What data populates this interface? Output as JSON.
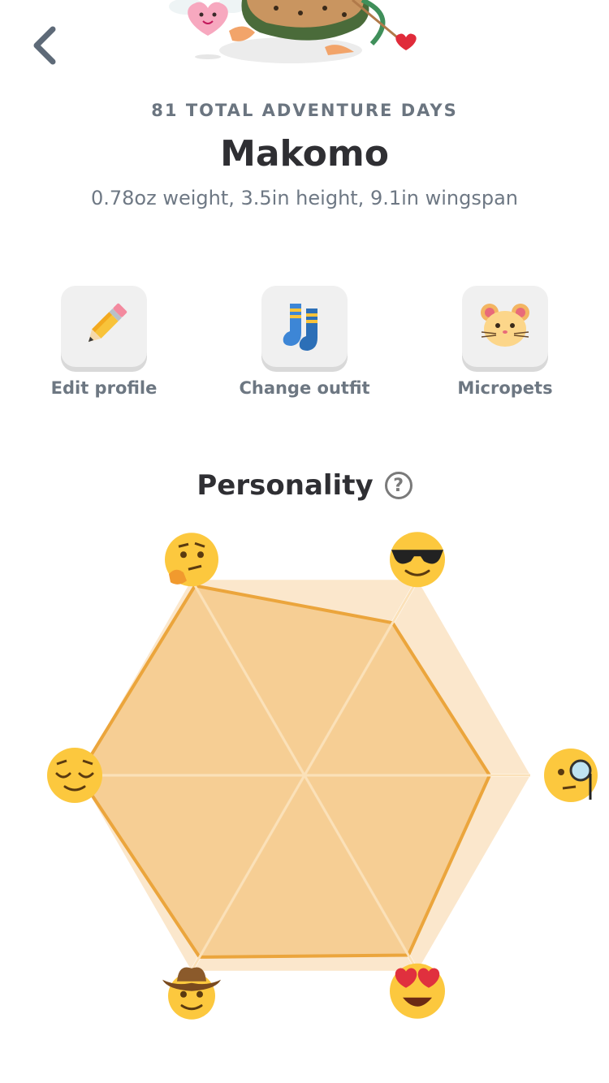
{
  "header": {
    "adventure_days": "81 TOTAL ADVENTURE DAYS",
    "name": "Makomo",
    "stats": "0.78oz weight, 3.5in height, 9.1in wingspan"
  },
  "actions": [
    {
      "label": "Edit profile",
      "icon": "pencil-icon"
    },
    {
      "label": "Change outfit",
      "icon": "socks-icon"
    },
    {
      "label": "Micropets",
      "icon": "hamster-icon"
    }
  ],
  "personality": {
    "title": "Personality",
    "help_glyph": "?",
    "traits": [
      {
        "icon": "thinking-face-icon",
        "value": 0.97
      },
      {
        "icon": "sunglasses-face-icon",
        "value": 0.78
      },
      {
        "icon": "monocle-face-icon",
        "value": 0.82
      },
      {
        "icon": "heart-eyes-face-icon",
        "value": 0.92
      },
      {
        "icon": "cowboy-face-icon",
        "value": 0.93
      },
      {
        "icon": "relieved-face-icon",
        "value": 1.0
      }
    ]
  },
  "colors": {
    "radar_outer": "#fbe7cc",
    "radar_fill": "#f4c98a",
    "radar_stroke": "#eba53c",
    "face": "#fcc83e"
  }
}
